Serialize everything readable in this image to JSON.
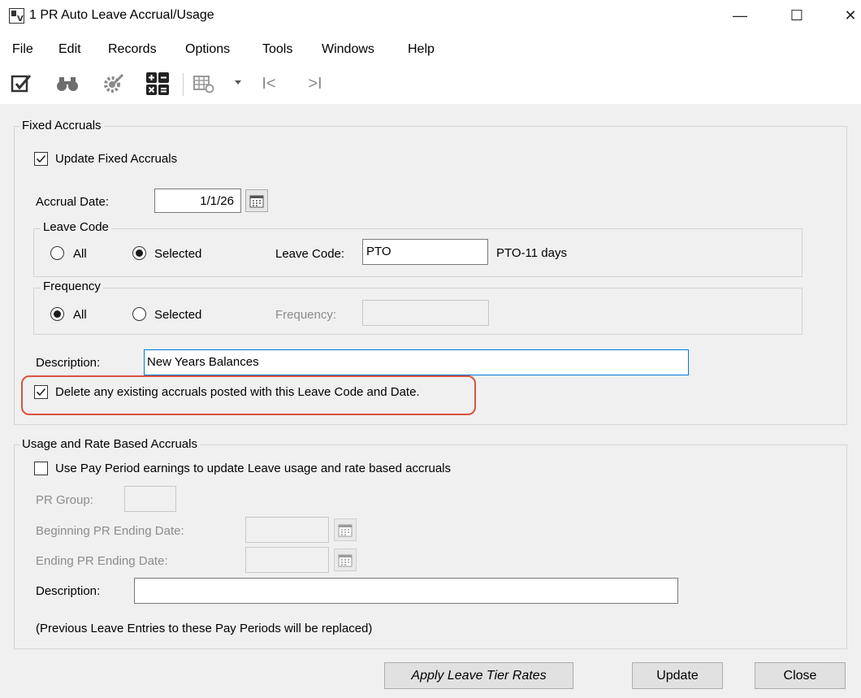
{
  "window": {
    "title": "1 PR Auto Leave Accrual/Usage",
    "minimize": "—",
    "maximize": "☐",
    "close": "✕"
  },
  "menu": [
    "File",
    "Edit",
    "Records",
    "Options",
    "Tools",
    "Windows",
    "Help"
  ],
  "toolbar": {
    "first_record": "I<",
    "last_record": ">I"
  },
  "fixed": {
    "group_label": "Fixed Accruals",
    "update_checkbox_label": "Update Fixed Accruals",
    "update_checked": true,
    "accrual_date_label": "Accrual Date:",
    "accrual_date_value": "1/1/26",
    "leave_code_group": "Leave Code",
    "leave_all_label": "All",
    "leave_selected_label": "Selected",
    "leave_code_label": "Leave Code:",
    "leave_code_value": "PTO",
    "leave_code_desc": "PTO-11 days",
    "frequency_group": "Frequency",
    "freq_all_label": "All",
    "freq_selected_label": "Selected",
    "frequency_label": "Frequency:",
    "frequency_value": "",
    "description_label": "Description:",
    "description_value": "New Years Balances",
    "delete_label": "Delete any existing accruals posted with this Leave Code and Date.",
    "delete_checked": true
  },
  "usage": {
    "group_label": "Usage and Rate Based Accruals",
    "use_pay_period_label": "Use Pay Period earnings to update Leave usage and rate based accruals",
    "use_pay_period_checked": false,
    "pr_group_label": "PR Group:",
    "beginning_label": "Beginning PR Ending Date:",
    "ending_label": "Ending PR Ending Date:",
    "description_label": "Description:",
    "description_value": "",
    "note": "(Previous Leave Entries to these Pay Periods will be replaced)"
  },
  "buttons": {
    "apply": "Apply Leave Tier Rates",
    "update": "Update",
    "close": "Close"
  },
  "colors": {
    "highlight": "#d9533f",
    "focus_border": "#0078d7"
  }
}
